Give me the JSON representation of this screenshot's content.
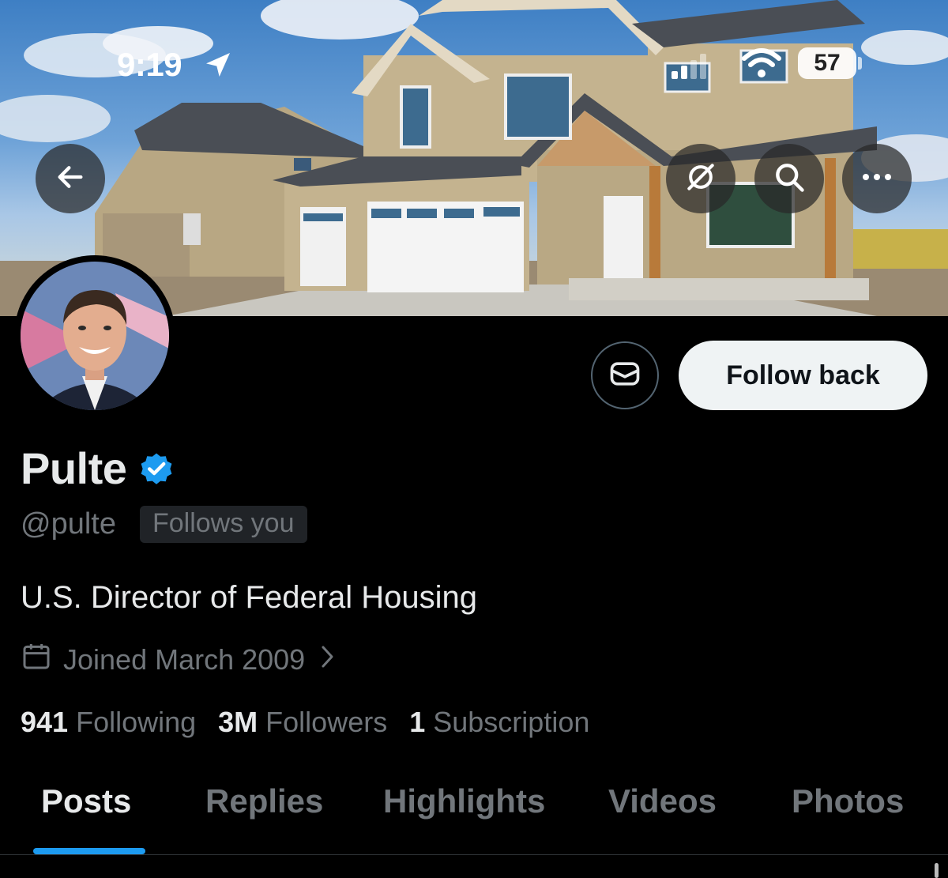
{
  "status_bar": {
    "time": "9:19",
    "battery": "57",
    "icons": [
      "location-arrow-icon",
      "cellular-signal-icon",
      "wifi-icon",
      "battery-icon"
    ]
  },
  "banner": {
    "description_icons": [
      "back-arrow-icon",
      "grok-slash-icon",
      "search-icon",
      "more-icon"
    ]
  },
  "profile": {
    "display_name": "Pulte",
    "handle": "@pulte",
    "follows_you": "Follows you",
    "bio": "U.S. Director of Federal Housing",
    "joined": "Joined March 2009",
    "follow_button": "Follow back"
  },
  "stats": [
    {
      "num": "941",
      "label": "Following"
    },
    {
      "num": "3M",
      "label": "Followers"
    },
    {
      "num": "1",
      "label": "Subscription"
    }
  ],
  "tabs": [
    "Posts",
    "Replies",
    "Highlights",
    "Videos",
    "Photos"
  ],
  "active_tab": "Posts",
  "colors": {
    "accent": "#1d9bf0",
    "background": "#000000",
    "secondary_text": "#71767b",
    "verified": "#1d9bf0"
  }
}
